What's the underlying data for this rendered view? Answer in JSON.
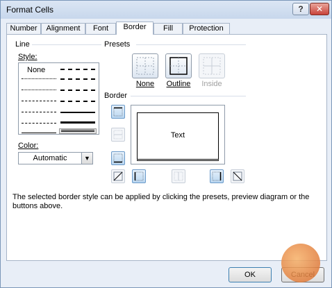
{
  "window": {
    "title": "Format Cells",
    "help_label": "?",
    "close_label": "✕"
  },
  "tabs": [
    {
      "label": "Number"
    },
    {
      "label": "Alignment"
    },
    {
      "label": "Font"
    },
    {
      "label": "Border"
    },
    {
      "label": "Fill"
    },
    {
      "label": "Protection"
    }
  ],
  "active_tab": "Border",
  "line": {
    "group_label": "Line",
    "style_label": "Style:",
    "none_label": "None",
    "color_label": "Color:",
    "color_value": "Automatic"
  },
  "presets": {
    "group_label": "Presets",
    "none_label": "None",
    "outline_label": "Outline",
    "inside_label": "Inside"
  },
  "border": {
    "group_label": "Border",
    "preview_text": "Text"
  },
  "info_text": "The selected border style can be applied by clicking the presets, preview diagram or the buttons above.",
  "buttons": {
    "ok": "OK",
    "cancel": "Cancel"
  },
  "colors": {
    "accent": "#6b9ac9",
    "title_bar": "#c7d7ec"
  }
}
